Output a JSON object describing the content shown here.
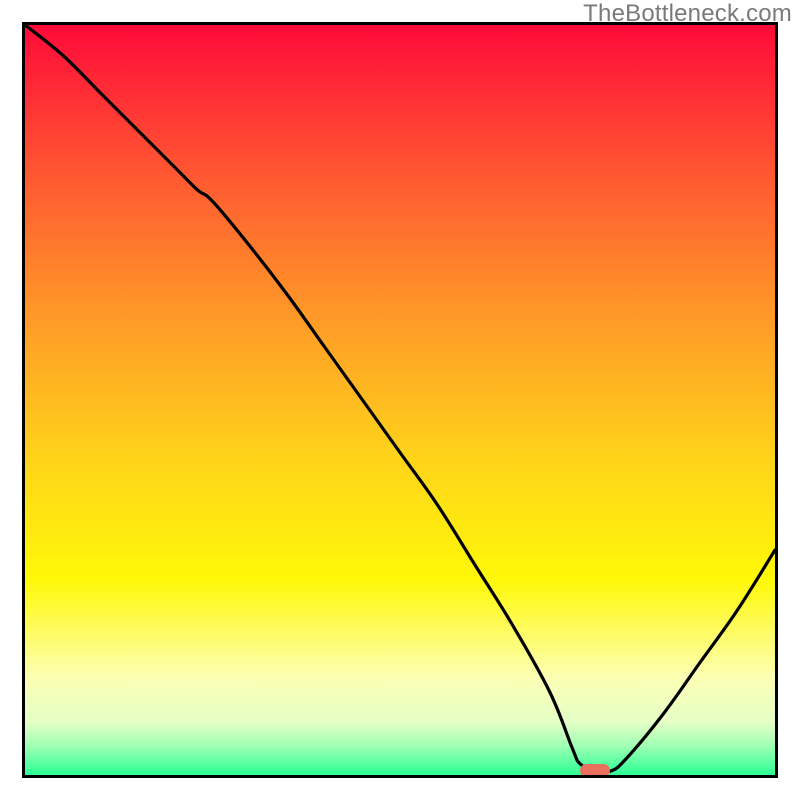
{
  "watermark": "TheBottleneck.com",
  "colors": {
    "border": "#000000",
    "curve": "#000000",
    "marker": "#e9705e",
    "gradient_stops": [
      {
        "offset": 0.0,
        "color": "#ff0a39"
      },
      {
        "offset": 0.2,
        "color": "#ff5832"
      },
      {
        "offset": 0.4,
        "color": "#ff9d27"
      },
      {
        "offset": 0.58,
        "color": "#ffd41a"
      },
      {
        "offset": 0.74,
        "color": "#fff808"
      },
      {
        "offset": 0.87,
        "color": "#fcffb4"
      },
      {
        "offset": 0.93,
        "color": "#e4ffc6"
      },
      {
        "offset": 0.96,
        "color": "#a2ffb4"
      },
      {
        "offset": 1.0,
        "color": "#2bff94"
      }
    ]
  },
  "chart_data": {
    "type": "line",
    "title": "",
    "xlabel": "",
    "ylabel": "",
    "xlim": [
      0,
      100
    ],
    "ylim": [
      0,
      100
    ],
    "grid": false,
    "legend": false,
    "description": "Bottleneck curve: value decreases from 100 at x=0, with a slight curvature change near x≈25, reaching a minimum near x≈73–78, then rises toward the right edge.",
    "x": [
      0,
      5,
      10,
      15,
      20,
      23,
      25,
      30,
      35,
      40,
      45,
      50,
      55,
      60,
      65,
      70,
      73,
      74,
      76,
      78,
      80,
      85,
      90,
      95,
      100
    ],
    "values": [
      100,
      96,
      91,
      86,
      81,
      78,
      76.5,
      70.5,
      64,
      57,
      50,
      43,
      36,
      28,
      20,
      11,
      3.5,
      1.5,
      0.5,
      0.5,
      2,
      8,
      15,
      22,
      30
    ],
    "marker": {
      "x_start": 74,
      "x_end": 78,
      "y": 0.6
    }
  }
}
